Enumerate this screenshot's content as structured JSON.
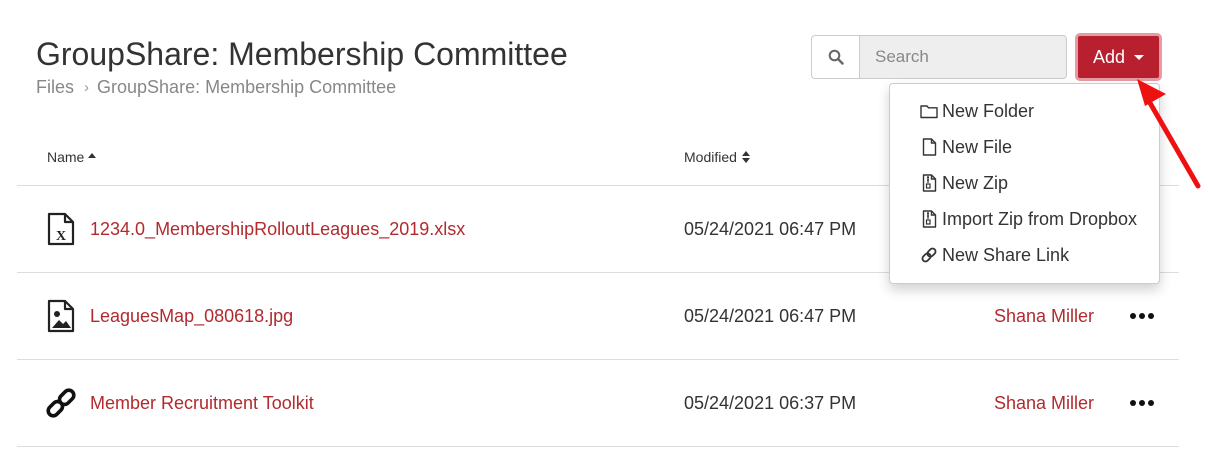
{
  "header": {
    "title": "GroupShare: Membership Committee",
    "breadcrumb": {
      "root": "Files",
      "separator": "›",
      "current": "GroupShare: Membership Committee"
    }
  },
  "search": {
    "placeholder": "Search",
    "value": "",
    "icon": "search-icon"
  },
  "add_button": {
    "label": "Add",
    "color": "#b8202f"
  },
  "dropdown": {
    "items": [
      {
        "label": "New Folder",
        "icon": "folder-icon"
      },
      {
        "label": "New File",
        "icon": "file-icon"
      },
      {
        "label": "New Zip",
        "icon": "zip-file-icon"
      },
      {
        "label": "Import Zip from Dropbox",
        "icon": "zip-file-icon"
      },
      {
        "label": "New Share Link",
        "icon": "link-icon"
      }
    ]
  },
  "table": {
    "columns": {
      "name": "Name",
      "modified": "Modified"
    },
    "rows": [
      {
        "name": "1234.0_MembershipRolloutLeagues_2019.xlsx",
        "modified": "05/24/2021 06:47 PM",
        "owner": "",
        "icon": "excel-file-icon"
      },
      {
        "name": "LeaguesMap_080618.jpg",
        "modified": "05/24/2021 06:47 PM",
        "owner": "Shana Miller",
        "icon": "image-file-icon"
      },
      {
        "name": "Member Recruitment Toolkit",
        "modified": "05/24/2021 06:37 PM",
        "owner": "Shana Miller",
        "icon": "link-icon"
      }
    ]
  },
  "colors": {
    "link": "#b22a2e",
    "accent": "#b8202f",
    "annotation_arrow": "#ee1111"
  }
}
